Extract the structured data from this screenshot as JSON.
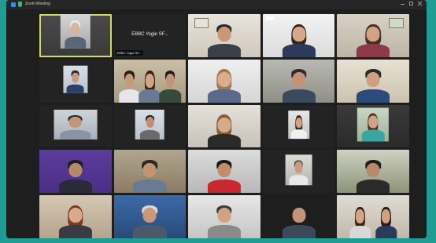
{
  "window": {
    "title": "Zoom Meeting",
    "colors": {
      "accent": "#2d8cff",
      "active_speaker": "#d8d85a",
      "background": "#1e1e1e",
      "desk": "#1f9c94"
    }
  },
  "participants": [
    {
      "name": "",
      "type": "video",
      "active": true
    },
    {
      "name": "EBBC Yogie SF...",
      "type": "name_only"
    },
    {
      "name": "",
      "type": "video"
    },
    {
      "name": "",
      "type": "video"
    },
    {
      "name": "",
      "type": "video"
    },
    {
      "name": "",
      "type": "thumbnail"
    },
    {
      "name": "",
      "type": "video"
    },
    {
      "name": "",
      "type": "video"
    },
    {
      "name": "",
      "type": "video"
    },
    {
      "name": "",
      "type": "video"
    },
    {
      "name": "",
      "type": "thumbnail"
    },
    {
      "name": "",
      "type": "thumbnail"
    },
    {
      "name": "",
      "type": "video"
    },
    {
      "name": "",
      "type": "thumbnail"
    },
    {
      "name": "",
      "type": "video"
    },
    {
      "name": "",
      "type": "video"
    },
    {
      "name": "",
      "type": "video"
    },
    {
      "name": "",
      "type": "video"
    },
    {
      "name": "",
      "type": "thumbnail"
    },
    {
      "name": "",
      "type": "video"
    },
    {
      "name": "",
      "type": "video"
    },
    {
      "name": "",
      "type": "video"
    },
    {
      "name": "",
      "type": "video"
    },
    {
      "name": "",
      "type": "video"
    },
    {
      "name": "",
      "type": "video"
    }
  ]
}
